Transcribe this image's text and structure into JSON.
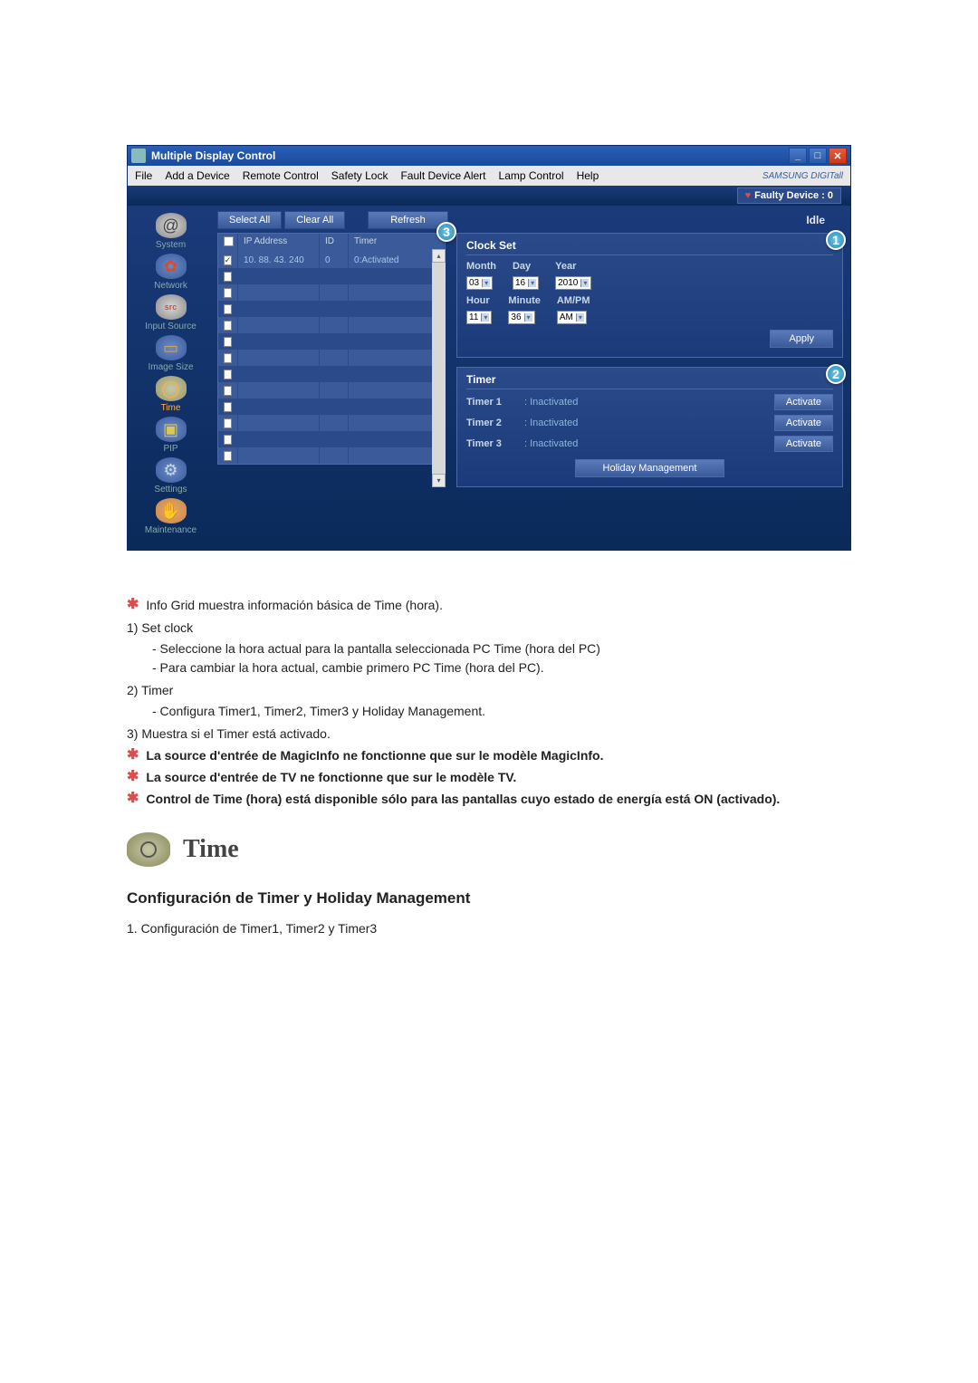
{
  "window": {
    "title": "Multiple Display Control",
    "menu": [
      "File",
      "Add a Device",
      "Remote Control",
      "Safety Lock",
      "Fault Device Alert",
      "Lamp Control",
      "Help"
    ],
    "brand": "SAMSUNG DIGITall",
    "faulty": "Faulty Device : 0",
    "idle": "Idle"
  },
  "sidebar": [
    {
      "label": "System",
      "cls": "ico-system",
      "glyph": "@"
    },
    {
      "label": "Network",
      "cls": "ico-network",
      "glyph": "✿"
    },
    {
      "label": "Input Source",
      "cls": "ico-input",
      "glyph": "source"
    },
    {
      "label": "Image Size",
      "cls": "ico-image",
      "glyph": "▭"
    },
    {
      "label": "Time",
      "cls": "ico-time",
      "glyph": "◯",
      "active": true
    },
    {
      "label": "PIP",
      "cls": "ico-pip",
      "glyph": "▣"
    },
    {
      "label": "Settings",
      "cls": "ico-settings",
      "glyph": "⚙"
    },
    {
      "label": "Maintenance",
      "cls": "ico-maint",
      "glyph": "✋"
    }
  ],
  "toolbar": {
    "select_all": "Select All",
    "clear_all": "Clear All",
    "refresh": "Refresh"
  },
  "grid": {
    "headers": {
      "ip": "IP Address",
      "id": "ID",
      "timer": "Timer"
    },
    "row": {
      "ip": "10. 88. 43. 240",
      "id": "0",
      "timer": "0:Activated"
    }
  },
  "clock": {
    "title": "Clock Set",
    "month_l": "Month",
    "day_l": "Day",
    "year_l": "Year",
    "hour_l": "Hour",
    "minute_l": "Minute",
    "ampm_l": "AM/PM",
    "month": "03",
    "day": "16",
    "year": "2010",
    "hour": "11",
    "minute": "36",
    "ampm": "AM",
    "apply": "Apply"
  },
  "timer": {
    "title": "Timer",
    "rows": [
      {
        "name": "Timer 1",
        "status": ": Inactivated",
        "btn": "Activate"
      },
      {
        "name": "Timer 2",
        "status": ": Inactivated",
        "btn": "Activate"
      },
      {
        "name": "Timer 3",
        "status": ": Inactivated",
        "btn": "Activate"
      }
    ],
    "holiday": "Holiday Management"
  },
  "doc": {
    "n1": "Info Grid muestra información básica de Time (hora).",
    "l1": "1)  Set clock",
    "l1a": "- Seleccione la hora actual para la pantalla seleccionada PC Time (hora del PC)",
    "l1b": "- Para cambiar la hora actual, cambie primero PC Time (hora del PC).",
    "l2": "2)  Timer",
    "l2a": "- Configura Timer1, Timer2, Timer3 y Holiday Management.",
    "l3": "3)  Muestra si el Timer está activado.",
    "n2": "La source d'entrée de MagicInfo ne fonctionne que sur le modèle MagicInfo.",
    "n3": "La source d'entrée de TV ne fonctionne que sur le modèle TV.",
    "n4": "Control de Time (hora) está disponible sólo para las pantallas cuyo estado de energía está ON (activado).",
    "h_time": "Time",
    "h_sub": "Configuración de Timer y Holiday Management",
    "s1": "1.  Configuración de Timer1, Timer2 y Timer3"
  }
}
